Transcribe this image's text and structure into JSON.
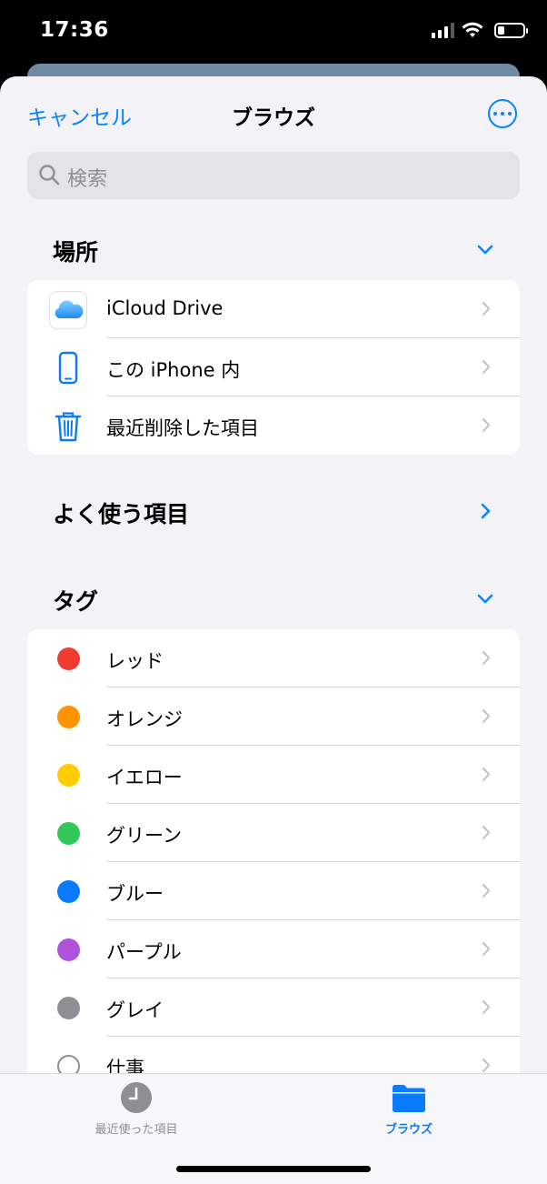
{
  "status": {
    "time": "17:36",
    "battery_level": 0.25
  },
  "nav": {
    "cancel_label": "キャンセル",
    "title": "ブラウズ",
    "more_icon": "ellipsis-circle-icon"
  },
  "search": {
    "placeholder": "検索"
  },
  "locations": {
    "title": "場所",
    "items": [
      {
        "label": "iCloud Drive",
        "icon": "icloud-icon"
      },
      {
        "label": "この iPhone 内",
        "icon": "iphone-icon"
      },
      {
        "label": "最近削除した項目",
        "icon": "trash-icon"
      }
    ]
  },
  "favorites": {
    "title": "よく使う項目"
  },
  "tags": {
    "title": "タグ",
    "items": [
      {
        "label": "レッド",
        "color": "#f23b30"
      },
      {
        "label": "オレンジ",
        "color": "#ff9400"
      },
      {
        "label": "イエロー",
        "color": "#ffcc00"
      },
      {
        "label": "グリーン",
        "color": "#33c659"
      },
      {
        "label": "ブルー",
        "color": "#0a7aff"
      },
      {
        "label": "パープル",
        "color": "#af52de"
      },
      {
        "label": "グレイ",
        "color": "#8e8e93"
      },
      {
        "label": "仕事",
        "color": ""
      }
    ]
  },
  "tabbar": {
    "recents_label": "最近使った項目",
    "browse_label": "ブラウズ",
    "active_color": "#0a7aff",
    "inactive_color": "#8e8e93"
  }
}
